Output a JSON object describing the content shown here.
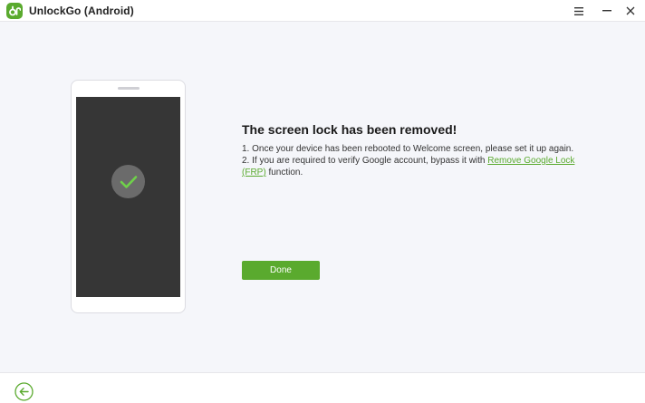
{
  "app": {
    "title": "UnlockGo (Android)",
    "logo_icon": "unlockgo-logo-icon",
    "accent_color": "#5aaa2e"
  },
  "titlebar": {
    "menu_icon": "hamburger-menu-icon",
    "minimize_icon": "minimize-icon",
    "close_icon": "close-icon"
  },
  "phone": {
    "screen_icon": "checkmark-icon"
  },
  "message": {
    "title": "The screen lock has been removed!",
    "line1": "1. Once your device has been rebooted to Welcome screen, please set it up again.",
    "line2_prefix": "2. If you are required to verify Google account, bypass it with ",
    "line2_link": "Remove Google Lock (FRP)",
    "line2_suffix": " function."
  },
  "actions": {
    "done_label": "Done"
  },
  "footer": {
    "back_icon": "back-arrow-icon"
  }
}
